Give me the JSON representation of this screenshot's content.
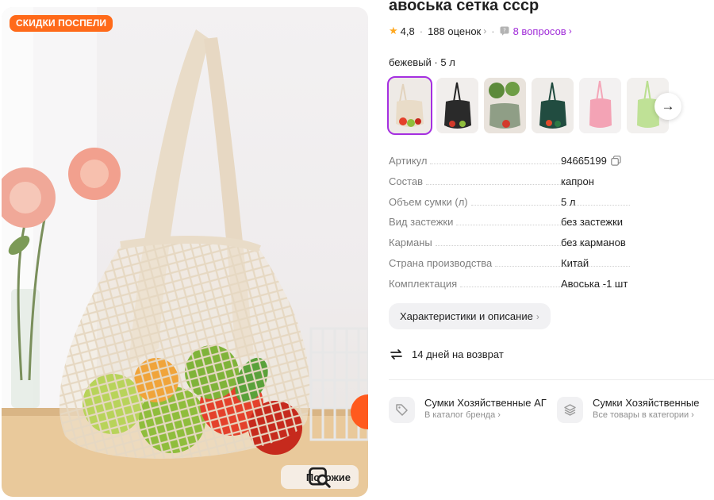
{
  "photo": {
    "badge": "СКИДКИ ПОСПЕЛИ",
    "similar_label": "Похожие"
  },
  "product": {
    "title": "авоська сетка ссср",
    "rating": "4,8",
    "reviews": "188 оценок",
    "questions": "8 вопросов",
    "variant": "бежевый · 5 л"
  },
  "thumbnails": [
    {
      "name": "beige",
      "selected": true
    },
    {
      "name": "black",
      "selected": false
    },
    {
      "name": "grey-green",
      "selected": false
    },
    {
      "name": "dark-green",
      "selected": false
    },
    {
      "name": "pink",
      "selected": false
    },
    {
      "name": "light-green",
      "selected": false
    }
  ],
  "specs": [
    {
      "key": "Артикул",
      "value": "94665199",
      "copy": true
    },
    {
      "key": "Состав",
      "value": "капрон"
    },
    {
      "key": "Объем сумки (л)",
      "value": "5 л"
    },
    {
      "key": "Вид застежки",
      "value": "без застежки"
    },
    {
      "key": "Карманы",
      "value": "без карманов"
    },
    {
      "key": "Страна производства",
      "value": "Китай"
    },
    {
      "key": "Комплектация",
      "value": "Авоська -1 шт"
    }
  ],
  "actions": {
    "characteristics_label": "Характеристики и описание",
    "return_label": "14 дней на возврат"
  },
  "brand_links": [
    {
      "name": "Сумки Хозяйственные АГ",
      "sub": "В каталог бренда",
      "icon": "tag-icon"
    },
    {
      "name": "Сумки Хозяйственные",
      "sub": "Все товары в категории",
      "icon": "layers-icon"
    }
  ],
  "colors": {
    "accent_purple": "#a02bd8",
    "badge_orange": "#ff6a1a",
    "star": "#ffa81f"
  }
}
